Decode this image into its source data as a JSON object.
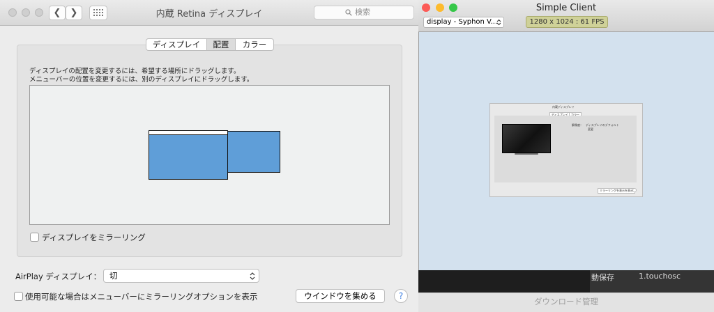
{
  "prefs": {
    "title": "内蔵 Retina ディスプレイ",
    "back_glyph": "❮",
    "forward_glyph": "❯",
    "search_placeholder": "検索",
    "tabs": [
      "ディスプレイ",
      "配置",
      "カラー"
    ],
    "active_tab": "配置",
    "instructions": [
      "ディスプレイの配置を変更するには、希望する場所にドラッグします。",
      "メニューバーの位置を変更するには、別のディスプレイにドラッグします。"
    ],
    "mirror_label": "ディスプレイをミラーリング",
    "airplay_label": "AirPlay ディスプレイ：",
    "airplay_value": "切",
    "menu_option_label": "使用可能な場合はメニューバーにミラーリングオプションを表示",
    "gather_button": "ウインドウを集める",
    "help_glyph": "?",
    "display_color": "#5f9ed8"
  },
  "client": {
    "title": "Simple Client",
    "source_select": "display - Syphon V...",
    "fps_badge": "1280 x 1024 : 61 FPS",
    "canvas_color": "#d3e1ee",
    "mini": {
      "title": "内蔵ディスプレイ",
      "tabs": [
        "ディスプレイ",
        "カラー"
      ],
      "opt1": "解像度：",
      "opt2": "ディスプレイのデフォルト",
      "opt3": "変更",
      "button": "ミラーリングを表示を表示"
    }
  },
  "background": {
    "tab1": "動保存",
    "tab2": "1.touchosc",
    "download_manager": "ダウンロード管理"
  },
  "traffic_lights": {
    "red": "#fc5b57",
    "yellow": "#fdbb2e",
    "green": "#35c748"
  }
}
